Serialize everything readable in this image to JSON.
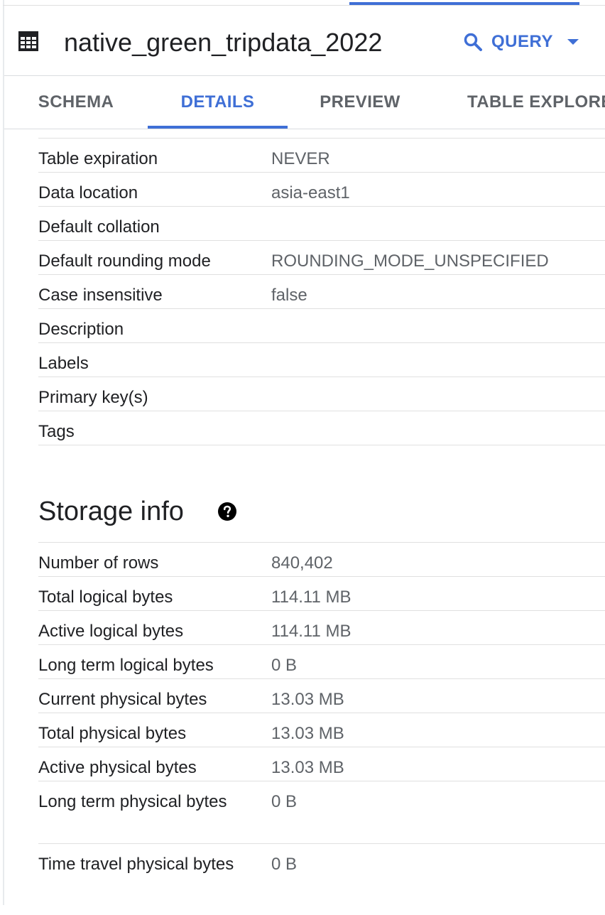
{
  "header": {
    "title": "native_green_tripdata_2022",
    "query_label": "QUERY",
    "table_icon": "table-grid-icon",
    "search_icon": "search-icon"
  },
  "tabs": [
    {
      "label": "SCHEMA",
      "active": false
    },
    {
      "label": "DETAILS",
      "active": true
    },
    {
      "label": "PREVIEW",
      "active": false
    },
    {
      "label": "TABLE EXPLORER",
      "active": false
    }
  ],
  "colors": {
    "accent": "#3f6fd6",
    "label_text": "#202124",
    "value_text": "#5f6368",
    "divider": "#e0e0e0"
  },
  "details": {
    "partial_top_text": "",
    "rows": [
      {
        "label": "Table expiration",
        "value": "NEVER"
      },
      {
        "label": "Data location",
        "value": "asia-east1"
      },
      {
        "label": "Default collation",
        "value": ""
      },
      {
        "label": "Default rounding mode",
        "value": "ROUNDING_MODE_UNSPECIFIED"
      },
      {
        "label": "Case insensitive",
        "value": "false"
      },
      {
        "label": "Description",
        "value": ""
      },
      {
        "label": "Labels",
        "value": ""
      },
      {
        "label": "Primary key(s)",
        "value": ""
      },
      {
        "label": "Tags",
        "value": ""
      }
    ]
  },
  "storage": {
    "title": "Storage info",
    "help_icon": "help-circle-icon",
    "rows": [
      {
        "label": "Number of rows",
        "value": "840,402"
      },
      {
        "label": "Total logical bytes",
        "value": "114.11 MB"
      },
      {
        "label": "Active logical bytes",
        "value": "114.11 MB"
      },
      {
        "label": "Long term logical bytes",
        "value": "0 B"
      },
      {
        "label": "Current physical bytes",
        "value": "13.03 MB"
      },
      {
        "label": "Total physical bytes",
        "value": "13.03 MB"
      },
      {
        "label": "Active physical bytes",
        "value": "13.03 MB"
      },
      {
        "label": "Long term physical bytes",
        "value": "0 B"
      },
      {
        "label": "Time travel physical bytes",
        "value": "0 B"
      }
    ]
  }
}
